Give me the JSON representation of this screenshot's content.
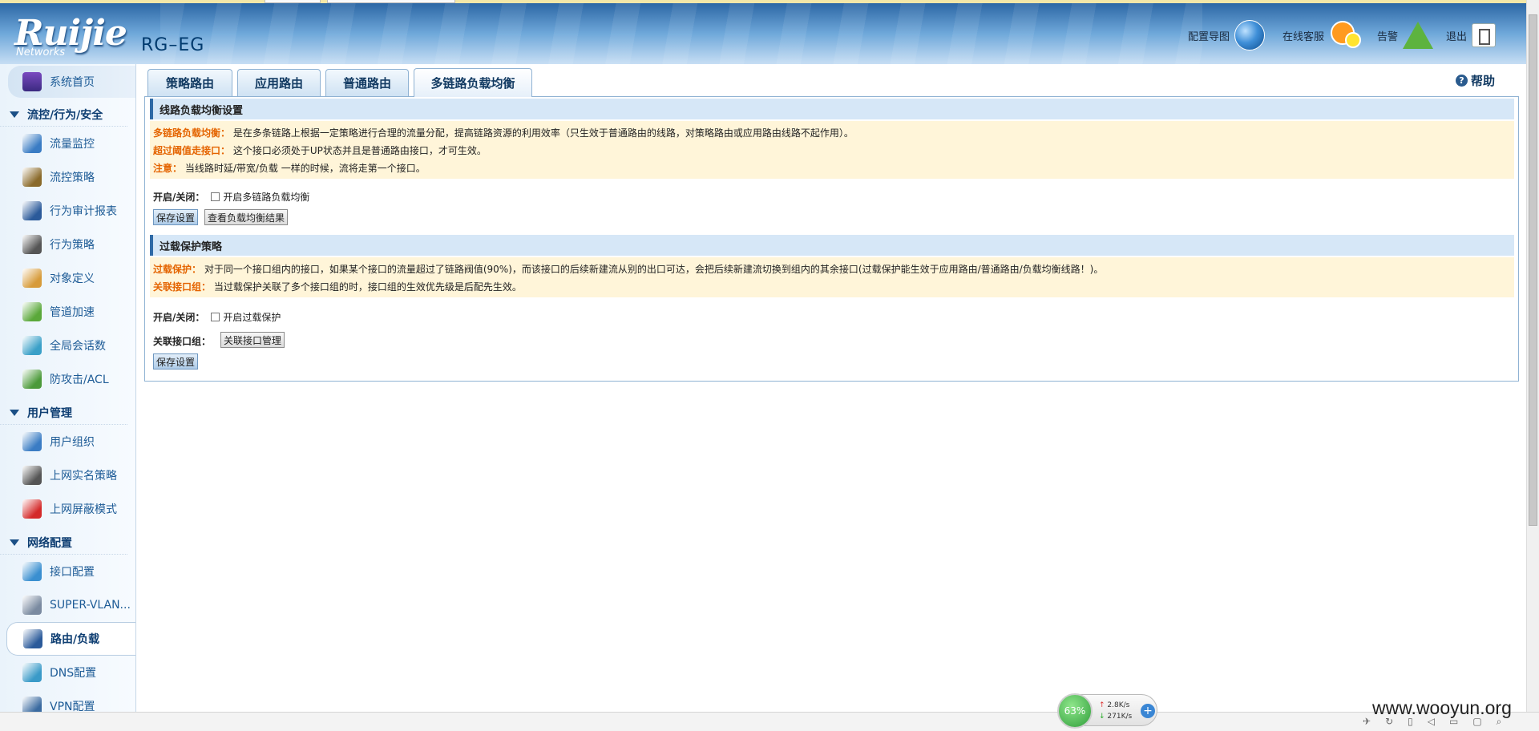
{
  "header": {
    "brand": "Ruijie",
    "brand_sub": "Networks",
    "model": "RG–EG",
    "links": [
      {
        "label": "配置导图",
        "icon": "globe-icon"
      },
      {
        "label": "在线客服",
        "icon": "support-icon"
      },
      {
        "label": "告警",
        "icon": "alarm-icon"
      },
      {
        "label": "退出",
        "icon": "exit-icon"
      }
    ]
  },
  "sidebar": {
    "home": {
      "label": "系统首页",
      "icon": "monitor-icon"
    },
    "sections": [
      {
        "title": "流控/行为/安全",
        "items": [
          {
            "label": "流量监控",
            "icon": "traffic-monitor-icon",
            "color": "#3a7cc4"
          },
          {
            "label": "流控策略",
            "icon": "flow-policy-icon",
            "color": "#8a6a2a"
          },
          {
            "label": "行为审计报表",
            "icon": "audit-report-icon",
            "color": "#2b5a9a"
          },
          {
            "label": "行为策略",
            "icon": "behavior-policy-icon",
            "color": "#555555"
          },
          {
            "label": "对象定义",
            "icon": "palette-icon",
            "color": "#d79b3a"
          },
          {
            "label": "管道加速",
            "icon": "accelerate-icon",
            "color": "#5aa83a"
          },
          {
            "label": "全局会话数",
            "icon": "sessions-icon",
            "color": "#3aa0c8"
          },
          {
            "label": "防攻击/ACL",
            "icon": "shield-icon",
            "color": "#4c9a3a"
          }
        ]
      },
      {
        "title": "用户管理",
        "items": [
          {
            "label": "用户组织",
            "icon": "user-org-icon",
            "color": "#3a7cc4"
          },
          {
            "label": "上网实名策略",
            "icon": "realname-icon",
            "color": "#555555"
          },
          {
            "label": "上网屏蔽模式",
            "icon": "block-icon",
            "color": "#d42a2a"
          }
        ]
      },
      {
        "title": "网络配置",
        "items": [
          {
            "label": "接口配置",
            "icon": "interface-icon",
            "color": "#3a8fd0"
          },
          {
            "label": "SUPER-VLAN...",
            "icon": "vlan-icon",
            "color": "#7a8aa0"
          },
          {
            "label": "路由/负载",
            "icon": "route-icon",
            "color": "#2b5a9a",
            "active": true
          },
          {
            "label": "DNS配置",
            "icon": "dns-icon",
            "color": "#3a9ac8"
          },
          {
            "label": "VPN配置",
            "icon": "vpn-icon",
            "color": "#3a6aa0"
          }
        ]
      }
    ]
  },
  "tabs": [
    {
      "label": "策略路由"
    },
    {
      "label": "应用路由"
    },
    {
      "label": "普通路由"
    },
    {
      "label": "多链路负载均衡",
      "active": true
    }
  ],
  "help_label": "帮助",
  "lb_section": {
    "title": "线路负载均衡设置",
    "notes": [
      {
        "key": "多链路负载均衡：",
        "text": "是在多条链路上根据一定策略进行合理的流量分配，提高链路资源的利用效率（只生效于普通路由的线路，对策略路由或应用路由线路不起作用）。"
      },
      {
        "key": "超过阈值走接口：",
        "text": "这个接口必须处于UP状态并且是普通路由接口，才可生效。"
      },
      {
        "key": "注意：",
        "text": "当线路时延/带宽/负载 一样的时候，流将走第一个接口。"
      }
    ],
    "toggle_label": "开启/关闭：",
    "checkbox_label": "开启多链路负载均衡",
    "save_label": "保存设置",
    "view_label": "查看负载均衡结果"
  },
  "op_section": {
    "title": "过载保护策略",
    "notes": [
      {
        "key": "过载保护：",
        "text": "对于同一个接口组内的接口，如果某个接口的流量超过了链路阀值(90%)，而该接口的后续新建流从别的出口可达，会把后续新建流切换到组内的其余接口(过载保护能生效于应用路由/普通路由/负载均衡线路！)。"
      },
      {
        "key": "关联接口组：",
        "text": "当过载保护关联了多个接口组的时，接口组的生效优先级是后配先生效。"
      }
    ],
    "toggle_label": "开启/关闭：",
    "checkbox_label": "开启过载保护",
    "group_label": "关联接口组：",
    "group_btn": "关联接口管理",
    "save_label": "保存设置"
  },
  "net_widget": {
    "percent": "63%",
    "up": "2.8K/s",
    "down": "271K/s"
  },
  "watermark": "www.wooyun.org"
}
